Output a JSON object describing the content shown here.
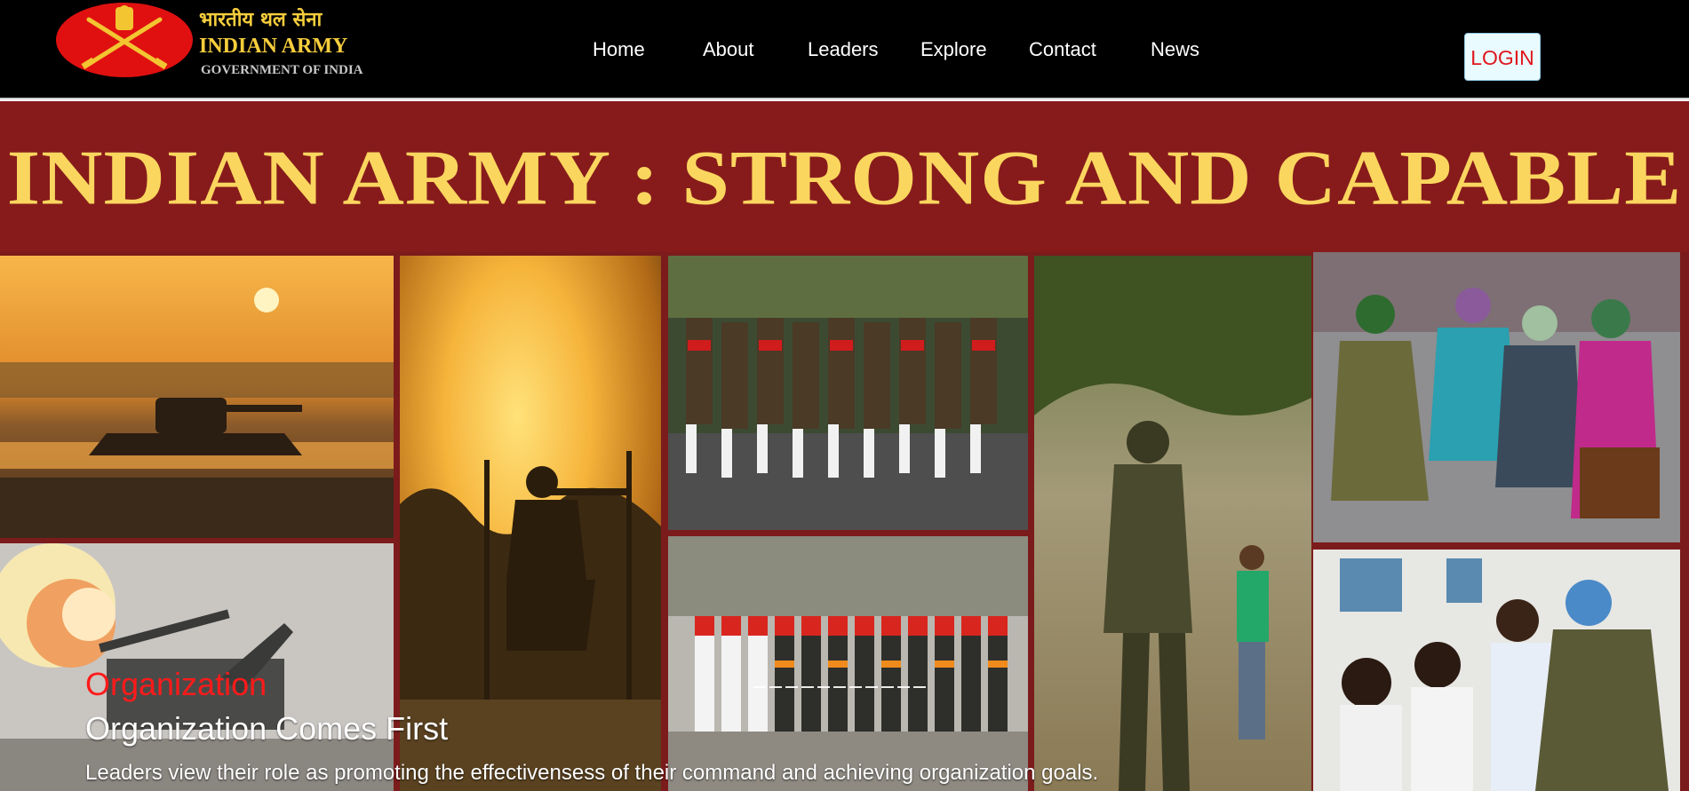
{
  "header": {
    "brand_hindi": "भारतीय थल सेना",
    "brand_name": "INDIAN ARMY",
    "brand_gov": "GOVERNMENT OF INDIA",
    "nav": [
      {
        "label": "Home"
      },
      {
        "label": "About"
      },
      {
        "label": "Leaders"
      },
      {
        "label": "Explore"
      },
      {
        "label": "Contact"
      },
      {
        "label": "News"
      }
    ],
    "login_label": "LOGIN"
  },
  "banner": {
    "title": "INDIAN ARMY : STRONG AND CAPABLE"
  },
  "gallery": {
    "photos": [
      {
        "subject": "tank-at-sunset"
      },
      {
        "subject": "soldier-aiming-at-sunset"
      },
      {
        "subject": "marching-contingent"
      },
      {
        "subject": "soldier-with-child"
      },
      {
        "subject": "soldier-with-villagers"
      },
      {
        "subject": "artillery-firing"
      },
      {
        "subject": "ceremonial-parade"
      },
      {
        "subject": "soldier-with-schoolchildren"
      }
    ]
  },
  "caption": {
    "kicker": "Organization",
    "title": "Organization Comes First",
    "text": "Leaders view their role as promoting the effectivensess of their command and achieving organization goals."
  },
  "colors": {
    "navbar_bg": "#000000",
    "banner_bg": "#871b1b",
    "banner_text": "#fbd65f",
    "kicker": "#ff1a1a",
    "login_text": "#e0161c"
  }
}
